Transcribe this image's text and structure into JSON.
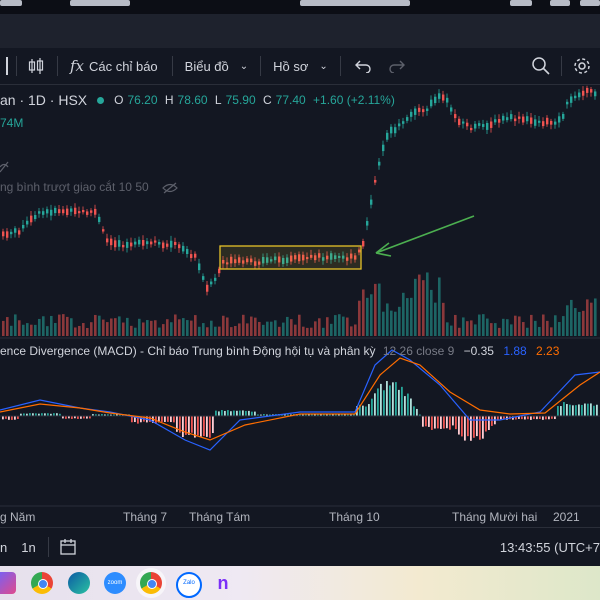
{
  "toolbar": {
    "indicators_label": "Các chỉ báo",
    "chart_type_label": "Biểu đồ",
    "profile_label": "Hồ sơ",
    "fx_glyph": "fx"
  },
  "legend": {
    "symbol": "an · 1D · HSX",
    "open_label": "O",
    "open": "76.20",
    "high_label": "H",
    "high": "78.60",
    "low_label": "L",
    "low": "75.90",
    "close_label": "C",
    "close": "77.40",
    "change": "+1.60 (+2.11%)",
    "volume": "74M",
    "ma_label": "ng bình trượt giao cắt 10 50"
  },
  "macd": {
    "label": "ence Divergence (MACD) - Chỉ báo Trung bình Động hội tụ và phân kỳ",
    "params": "12 26 close 9",
    "hist": "−0.35",
    "macd": "1.88",
    "signal": "2.23"
  },
  "time_axis": {
    "labels": [
      "g Năm",
      "Tháng 7",
      "Tháng Tám",
      "Tháng 10",
      "Tháng Mười hai",
      "2021"
    ]
  },
  "bottom": {
    "range_1": "n",
    "range_2": "1n",
    "clock": "13:43:55 (UTC+7"
  },
  "colors": {
    "up": "#26a69a",
    "down": "#ef5350",
    "macd_line": "#2962ff",
    "signal_line": "#ff6d00",
    "highlight": "#e6c229",
    "arrow": "#4caf50"
  }
}
